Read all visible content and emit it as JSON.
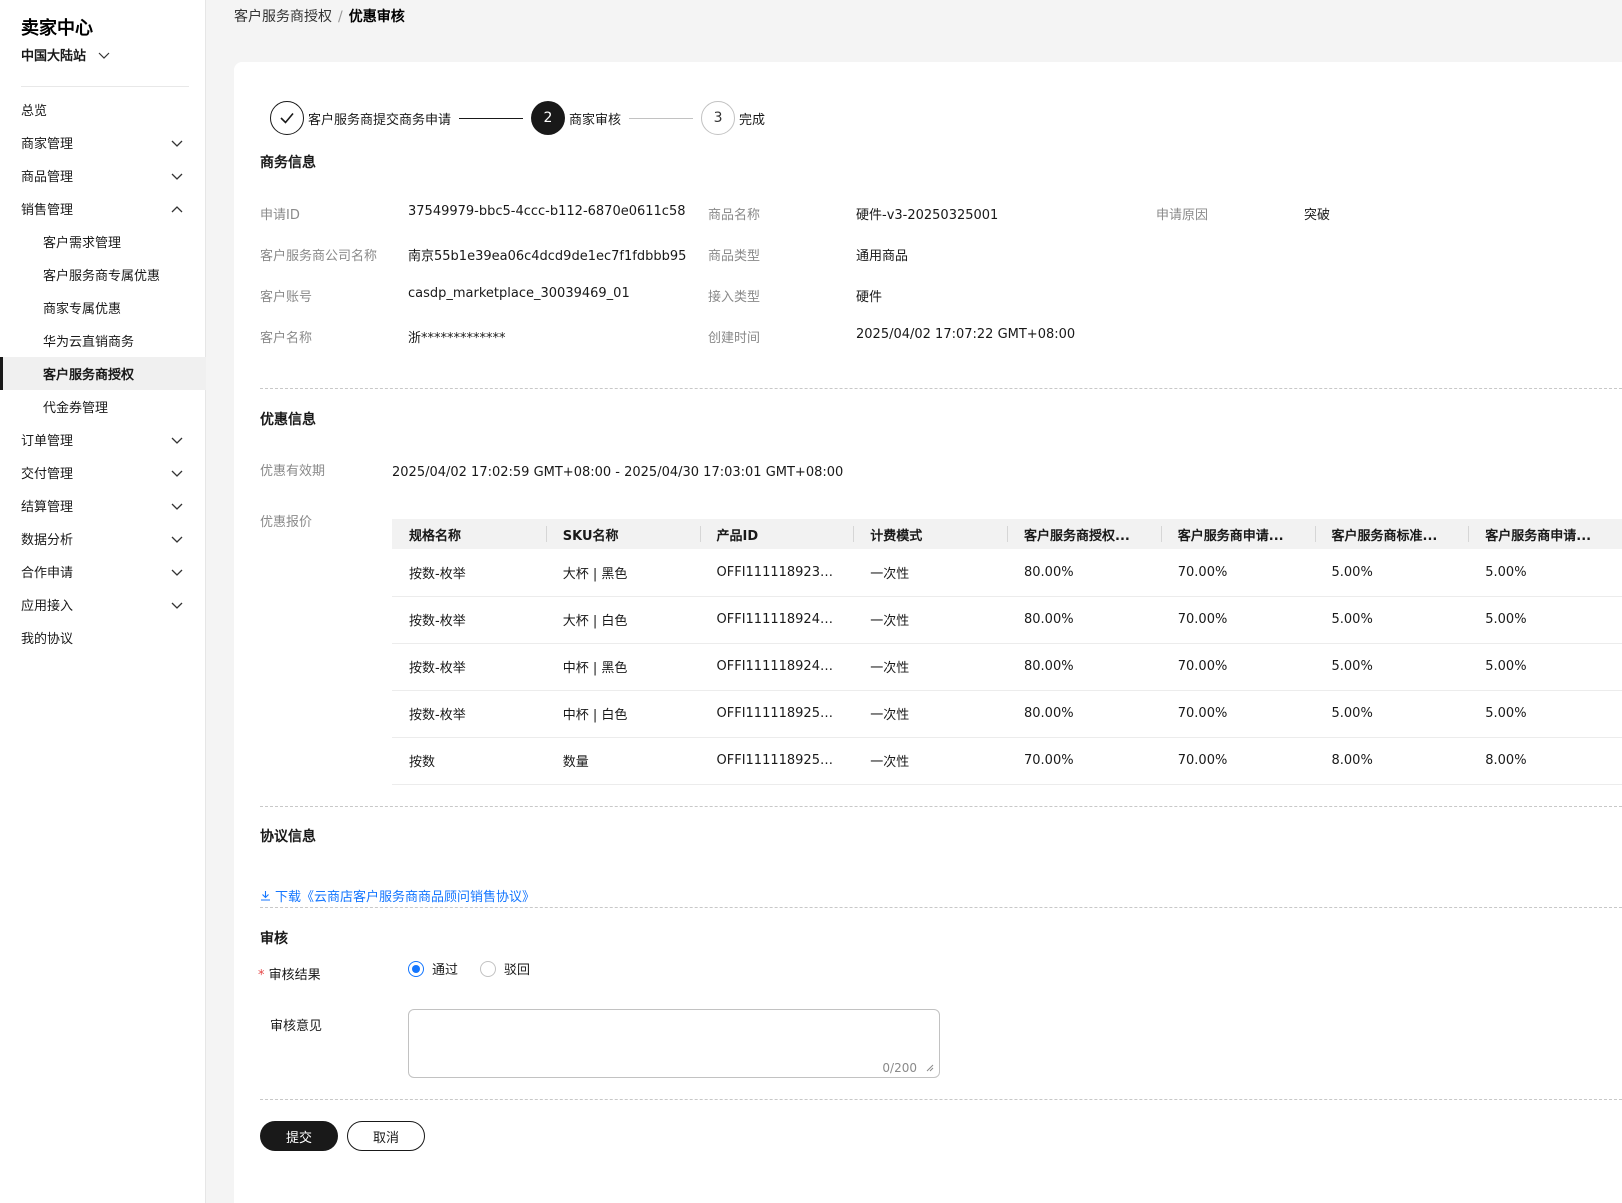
{
  "sidebar": {
    "brand": "卖家中心",
    "site": "中国大陆站",
    "items": [
      {
        "label": "总览",
        "expand": "none"
      },
      {
        "label": "商家管理",
        "expand": "down"
      },
      {
        "label": "商品管理",
        "expand": "down"
      },
      {
        "label": "销售管理",
        "expand": "up"
      },
      {
        "label": "客户需求管理",
        "sub": true
      },
      {
        "label": "客户服务商专属优惠",
        "sub": true
      },
      {
        "label": "商家专属优惠",
        "sub": true
      },
      {
        "label": "华为云直销商务",
        "sub": true
      },
      {
        "label": "客户服务商授权",
        "sub": true,
        "active": true
      },
      {
        "label": "代金券管理",
        "sub": true
      },
      {
        "label": "订单管理",
        "expand": "down"
      },
      {
        "label": "交付管理",
        "expand": "down"
      },
      {
        "label": "结算管理",
        "expand": "down"
      },
      {
        "label": "数据分析",
        "expand": "down"
      },
      {
        "label": "合作申请",
        "expand": "down"
      },
      {
        "label": "应用接入",
        "expand": "down"
      },
      {
        "label": "我的协议",
        "expand": "none"
      }
    ]
  },
  "breadcrumb": {
    "parent": "客户服务商授权",
    "sep": "/",
    "current": "优惠审核"
  },
  "steps": [
    {
      "label": "客户服务商提交商务申请",
      "state": "done",
      "number": ""
    },
    {
      "label": "商家审核",
      "state": "current",
      "number": "2"
    },
    {
      "label": "完成",
      "state": "todo",
      "number": "3"
    }
  ],
  "business": {
    "title": "商务信息",
    "fields": [
      {
        "label": "申请ID",
        "value": "37549979-bbc5-4ccc-b112-6870e0611c58"
      },
      {
        "label": "商品名称",
        "value": "硬件-v3-20250325001"
      },
      {
        "label": "申请原因",
        "value": "突破"
      },
      {
        "label": "客户服务商公司名称",
        "value": "南京55b1e39ea06c4dcd9de1ec7f1fdbbb95"
      },
      {
        "label": "商品类型",
        "value": "通用商品"
      },
      {
        "label": "客户账号",
        "value": "casdp_marketplace_30039469_01"
      },
      {
        "label": "接入类型",
        "value": "硬件"
      },
      {
        "label": "客户名称",
        "value": "浙*************"
      },
      {
        "label": "创建时间",
        "value": "2025/04/02 17:07:22 GMT+08:00"
      }
    ]
  },
  "discount": {
    "title": "优惠信息",
    "validity_label": "优惠有效期",
    "validity_value": "2025/04/02 17:02:59 GMT+08:00 - 2025/04/30 17:03:01 GMT+08:00",
    "quote_label": "优惠报价",
    "columns": [
      "规格名称",
      "SKU名称",
      "产品ID",
      "计费模式",
      "客户服务商授权...",
      "客户服务商申请...",
      "客户服务商标准...",
      "客户服务商申请..."
    ],
    "rows": [
      [
        "按数-枚举",
        "大杯 | 黑色",
        "OFFI1111189239...",
        "一次性",
        "80.00%",
        "70.00%",
        "5.00%",
        "5.00%"
      ],
      [
        "按数-枚举",
        "大杯 | 白色",
        "OFFI1111189243...",
        "一次性",
        "80.00%",
        "70.00%",
        "5.00%",
        "5.00%"
      ],
      [
        "按数-枚举",
        "中杯 | 黑色",
        "OFFI1111189247...",
        "一次性",
        "80.00%",
        "70.00%",
        "5.00%",
        "5.00%"
      ],
      [
        "按数-枚举",
        "中杯 | 白色",
        "OFFI1111189252...",
        "一次性",
        "80.00%",
        "70.00%",
        "5.00%",
        "5.00%"
      ],
      [
        "按数",
        "数量",
        "OFFI1111189257...",
        "一次性",
        "70.00%",
        "70.00%",
        "8.00%",
        "8.00%"
      ]
    ]
  },
  "agreement": {
    "title": "协议信息",
    "download_text": "下载《云商店客户服务商商品顾问销售协议》"
  },
  "review": {
    "title": "审核",
    "required_mark": "*",
    "result_label": "审核结果",
    "options": [
      {
        "label": "通过",
        "checked": true
      },
      {
        "label": "驳回",
        "checked": false
      }
    ],
    "comment_label": "审核意见",
    "comment_value": "",
    "counter": "0/200"
  },
  "actions": {
    "submit": "提交",
    "cancel": "取消"
  }
}
